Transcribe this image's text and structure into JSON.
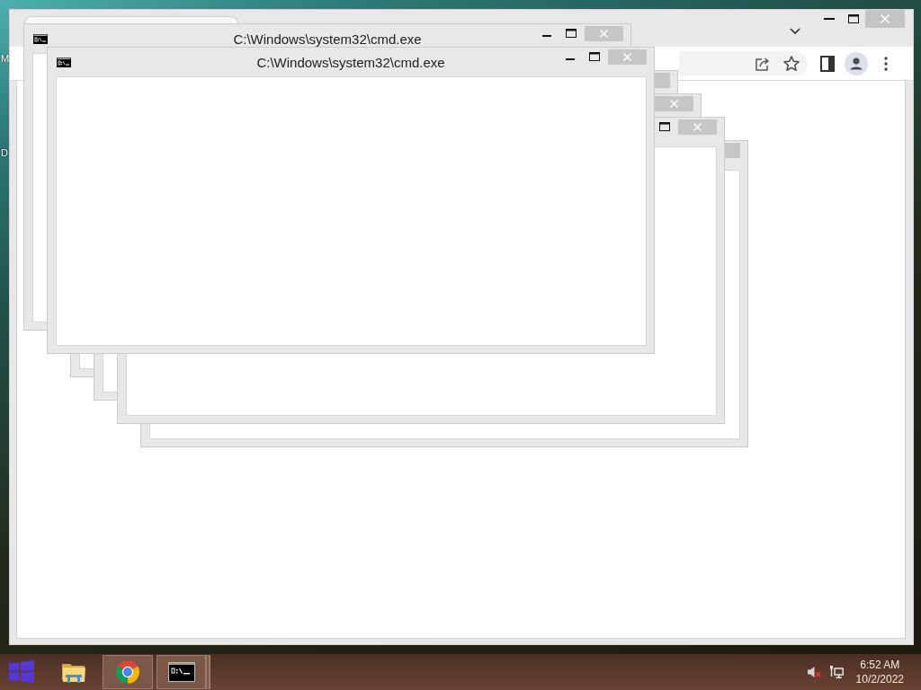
{
  "desktop": {
    "icon_labels": [
      "M",
      "D"
    ]
  },
  "browser": {
    "tabs": [
      {
        "selected": true
      }
    ]
  },
  "console_windows": [
    {
      "title": "C:\\Windows\\system32\\cmd.exe",
      "show_icon": true,
      "focused": false,
      "controls": [
        {
          "kind": "minimize"
        },
        {
          "kind": "maximize"
        },
        {
          "kind": "close"
        }
      ]
    },
    {
      "title": "C:\\Windows\\system32\\cmd.exe",
      "show_icon": true,
      "focused": true,
      "controls": [
        {
          "kind": "minimize"
        },
        {
          "kind": "maximize"
        },
        {
          "kind": "close"
        }
      ]
    },
    {
      "focused": false,
      "controls": [
        {
          "kind": "close_edge"
        }
      ]
    },
    {
      "focused": false,
      "controls": [
        {
          "kind": "close"
        }
      ]
    },
    {
      "focused": false,
      "controls": [
        {
          "kind": "maximize"
        },
        {
          "kind": "close"
        }
      ]
    },
    {
      "focused": false,
      "controls": [
        {
          "kind": "close_edge"
        }
      ]
    }
  ],
  "taskbar": {
    "apps": [
      {
        "kind": "files",
        "running": false,
        "grouped": false
      },
      {
        "kind": "browser",
        "running": true,
        "grouped": false
      },
      {
        "kind": "console",
        "running": true,
        "grouped": true
      }
    ],
    "tray": {
      "muted": true
    },
    "clock": {
      "time": "6:52 AM",
      "date": "10/2/2022"
    }
  }
}
